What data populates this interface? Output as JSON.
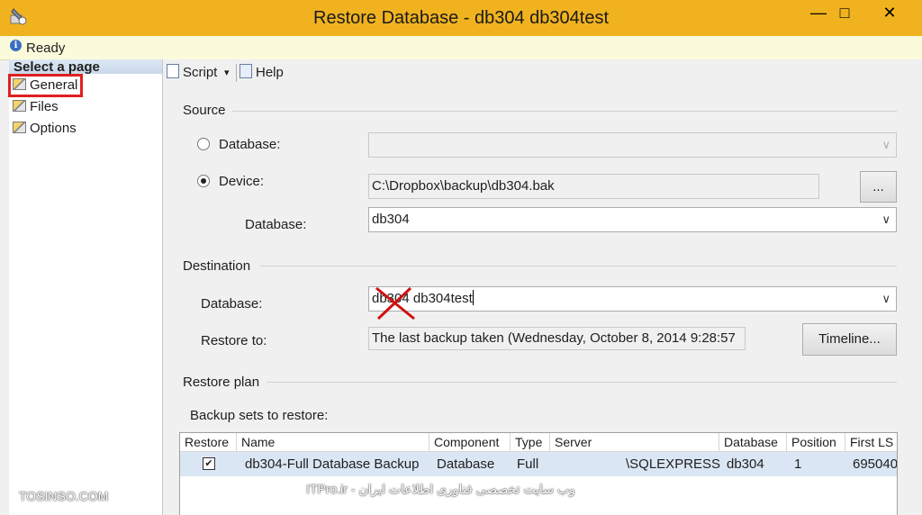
{
  "window": {
    "title": "Restore Database - db304  db304test",
    "minimize_glyph": "—",
    "maximize_glyph": "□",
    "close_glyph": "✕"
  },
  "status": {
    "icon": "info-icon",
    "icon_glyph": "i",
    "text": "Ready"
  },
  "left_pane": {
    "header": "Select a page",
    "items": [
      {
        "label": "General",
        "icon": "page-icon",
        "highlighted": true
      },
      {
        "label": "Files",
        "icon": "page-icon"
      },
      {
        "label": "Options",
        "icon": "page-icon"
      }
    ]
  },
  "toolbar": {
    "script_label": "Script",
    "dropdown_glyph": "▾",
    "help_label": "Help"
  },
  "source": {
    "heading": "Source",
    "database_radio_label": "Database:",
    "database_value": "",
    "device_radio_label": "Device:",
    "device_value": "C:\\Dropbox\\backup\\db304.bak",
    "browse_label": "...",
    "device_database_label": "Database:",
    "device_database_value": "db304",
    "selected": "device"
  },
  "destination": {
    "heading": "Destination",
    "database_label": "Database:",
    "database_value": "db304  db304test",
    "restore_to_label": "Restore to:",
    "restore_to_value": "The last backup taken (Wednesday, October 8, 2014 9:28:57",
    "timeline_label": "Timeline..."
  },
  "restore_plan": {
    "heading": "Restore plan",
    "backup_sets_label": "Backup sets to restore:",
    "columns": [
      "Restore",
      "Name",
      "Component",
      "Type",
      "Server",
      "Database",
      "Position",
      "First LS"
    ],
    "rows": [
      {
        "restore": true,
        "check_glyph": "✔",
        "name": "db304-Full Database Backup",
        "component": "Database",
        "type": "Full",
        "server": "\\SQLEXPRESS",
        "database": "db304",
        "position": "1",
        "first_lsn": "695040"
      }
    ]
  },
  "watermarks": {
    "left": "TOSINSO.COM",
    "center": "ITPro.ir - وب سایت تخصصی فناوری اطلاعات ایران"
  },
  "colors": {
    "title_bar": "#f0b31f",
    "status_bar": "#fbfbdc",
    "highlight_box": "#e02020",
    "selected_row": "#dbe6f4",
    "strike_mark": "#d01010"
  }
}
